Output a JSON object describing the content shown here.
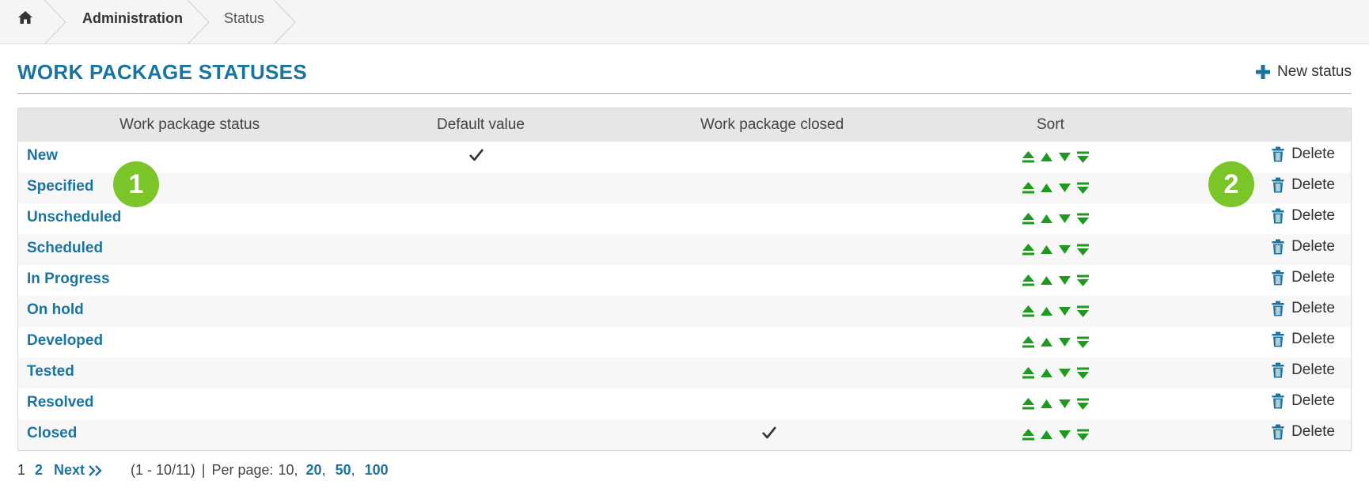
{
  "breadcrumb": {
    "home_icon": "home-icon",
    "items": [
      {
        "label": "Administration"
      },
      {
        "label": "Status"
      }
    ]
  },
  "header": {
    "title": "WORK PACKAGE STATUSES",
    "new_status_label": "New status"
  },
  "table": {
    "columns": {
      "status": "Work package status",
      "default": "Default value",
      "closed": "Work package closed",
      "sort": "Sort"
    },
    "delete_label": "Delete",
    "rows": [
      {
        "name": "New",
        "default": true,
        "closed": false
      },
      {
        "name": "Specified",
        "default": false,
        "closed": false
      },
      {
        "name": "Unscheduled",
        "default": false,
        "closed": false
      },
      {
        "name": "Scheduled",
        "default": false,
        "closed": false
      },
      {
        "name": "In Progress",
        "default": false,
        "closed": false
      },
      {
        "name": "On hold",
        "default": false,
        "closed": false
      },
      {
        "name": "Developed",
        "default": false,
        "closed": false
      },
      {
        "name": "Tested",
        "default": false,
        "closed": false
      },
      {
        "name": "Resolved",
        "default": false,
        "closed": false
      },
      {
        "name": "Closed",
        "default": false,
        "closed": true
      }
    ]
  },
  "badges": {
    "one": "1",
    "two": "2"
  },
  "pagination": {
    "current_page": "1",
    "page_2": "2",
    "next_label": "Next",
    "range": "(1 - 10/11)",
    "separator": "|",
    "per_page_label": "Per page:",
    "per_page_current": "10,",
    "per_page_20": "20",
    "per_page_50": "50",
    "per_page_100": "100"
  },
  "colors": {
    "link": "#1a74a0",
    "sort_icon": "#1e9a1e",
    "badge": "#7bc528",
    "header_bg": "#e6e6e6"
  }
}
